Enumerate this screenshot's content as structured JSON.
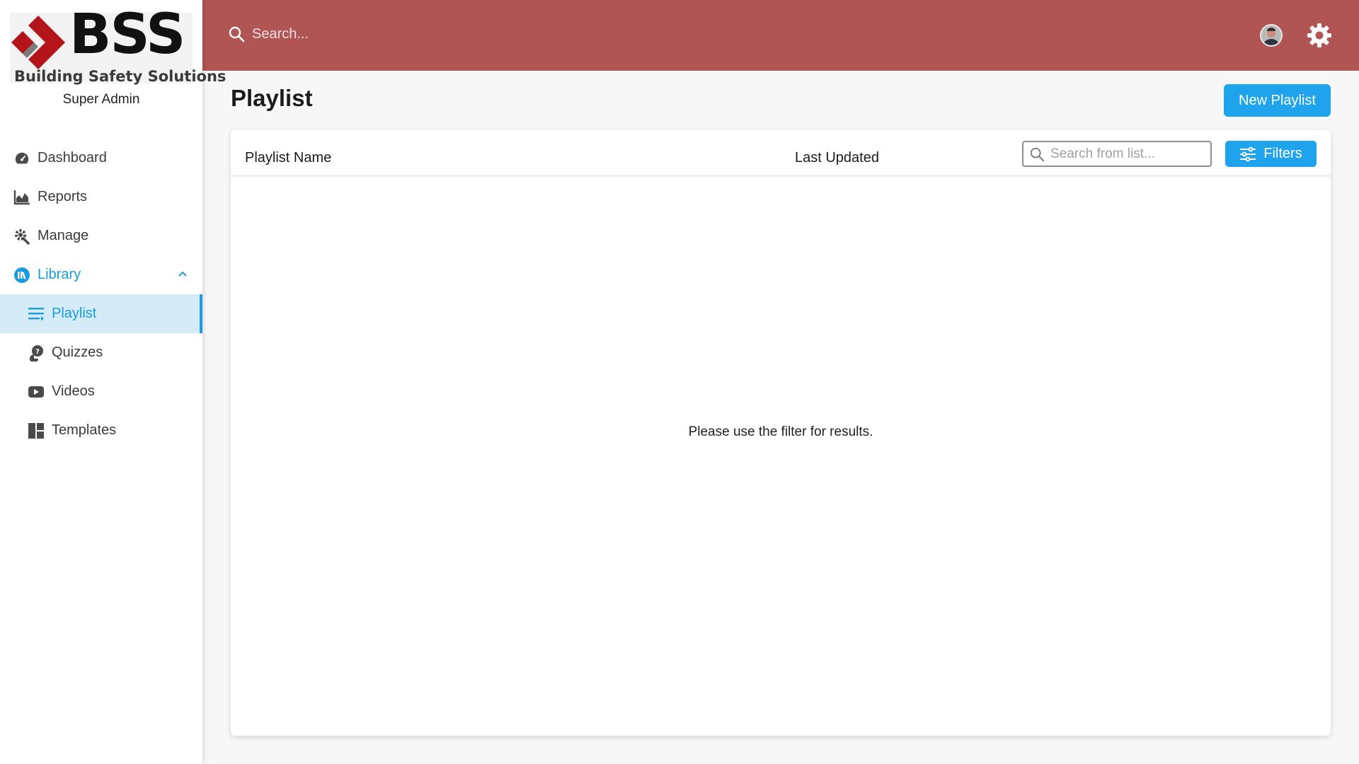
{
  "brand": {
    "logo_text": "BSS",
    "tagline": "Building Safety Solutions",
    "role": "Super Admin",
    "colors": {
      "logo_red": "#b3151b",
      "logo_grey": "#7a7a7a"
    }
  },
  "topbar": {
    "search_placeholder": "Search...",
    "color": "#b05454"
  },
  "sidebar": {
    "items": [
      {
        "label": "Dashboard",
        "icon": "speedometer-icon"
      },
      {
        "label": "Reports",
        "icon": "area-chart-icon"
      },
      {
        "label": "Manage",
        "icon": "cog-wrench-icon"
      },
      {
        "label": "Library",
        "icon": "library-icon",
        "expanded": true
      },
      {
        "label": "Playlist",
        "icon": "list-icon",
        "selected": true
      },
      {
        "label": "Quizzes",
        "icon": "question-chat-icon"
      },
      {
        "label": "Videos",
        "icon": "play-icon"
      },
      {
        "label": "Templates",
        "icon": "template-grid-icon"
      }
    ]
  },
  "main": {
    "title": "Playlist",
    "new_button": "New Playlist",
    "columns": {
      "name": "Playlist Name",
      "updated": "Last Updated"
    },
    "list_search_placeholder": "Search from list...",
    "filters_label": "Filters",
    "empty_message": "Please use the filter for results.",
    "accent": "#1ea3ec"
  }
}
